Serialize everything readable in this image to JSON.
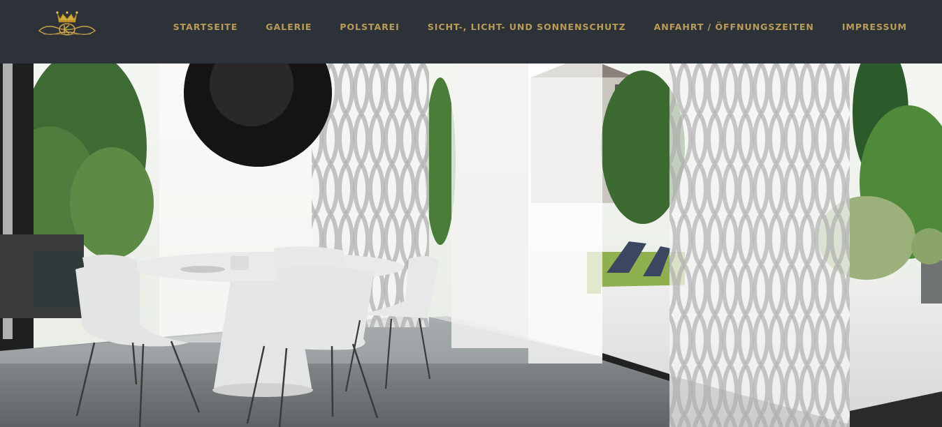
{
  "header": {
    "logo_icon": "crown-emblem-logo",
    "nav_items": [
      {
        "label": "STARTSEITE"
      },
      {
        "label": "GALERIE"
      },
      {
        "label": "POLSTAREI"
      },
      {
        "label": "SICHT-, LICHT- UND SONNENSCHUTZ"
      },
      {
        "label": "ANFAHRT / ÖFFNUNGSZEITEN"
      },
      {
        "label": "IMPRESSUM"
      }
    ]
  },
  "hero": {
    "image_icon": "hero-photo-panel-curtains-dining-room"
  },
  "colors": {
    "navbar_bg": "#2d3138",
    "nav_text": "#b99c57",
    "logo_gold": "#c9a448"
  }
}
